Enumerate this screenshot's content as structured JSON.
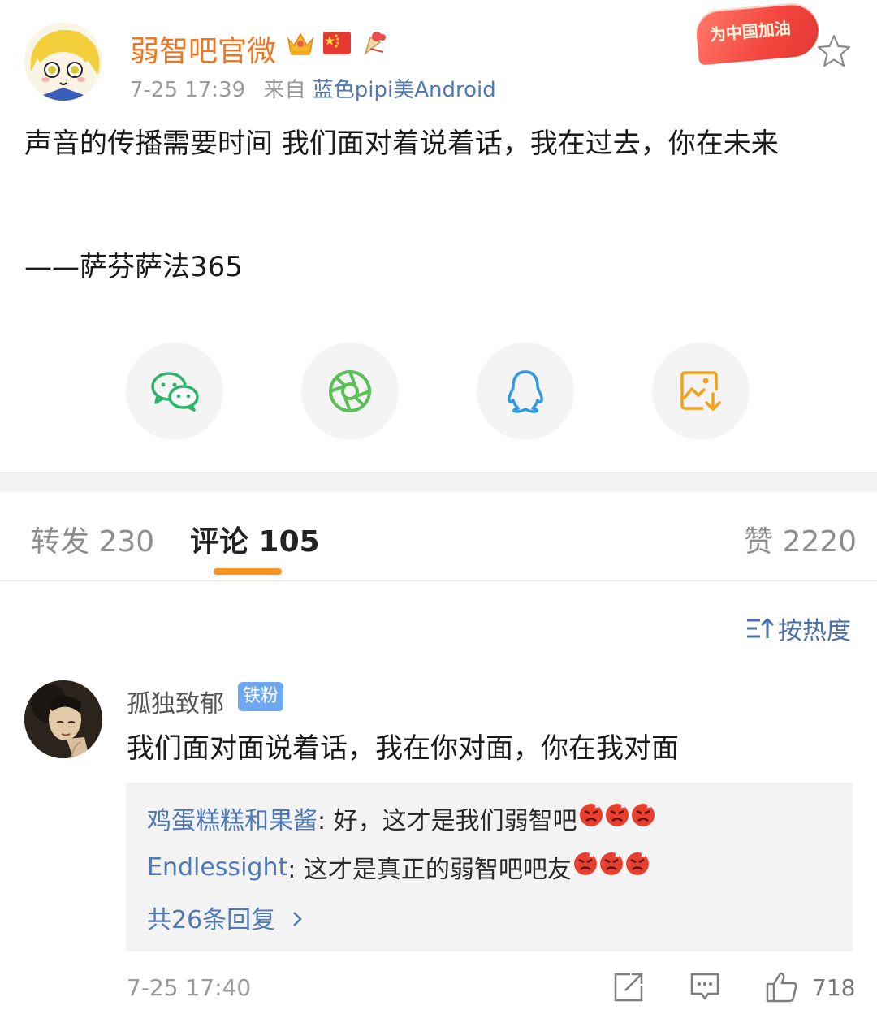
{
  "post": {
    "author": "弱智吧官微",
    "time": "7-25 17:39",
    "source_prefix": "来自",
    "source": "蓝色pipi美Android",
    "promo_label": "为中国加油",
    "text": "声音的传播需要时间 我们面对着说着话，我在过去，你在未来",
    "signature": "——萨芬萨法365",
    "badges": [
      "crown-icon",
      "china-flag-icon",
      "festive-bell-icon"
    ]
  },
  "share": {
    "items": [
      {
        "icon": "wechat-icon",
        "color": "#2cb46b"
      },
      {
        "icon": "moments-icon",
        "color": "#5cbf59"
      },
      {
        "icon": "qq-icon",
        "color": "#2d9be6"
      },
      {
        "icon": "save-image-icon",
        "color": "#f4a018"
      }
    ]
  },
  "tabs": {
    "repost": "转发 230",
    "comment": "评论 105",
    "like": "赞 2220"
  },
  "sort_label": "按热度",
  "comment": {
    "user": "孤独致郁",
    "badge": "铁粉",
    "text": "我们面对面说着话，我在你对面，你在我对面",
    "replies": [
      {
        "user": "鸡蛋糕糕和果酱",
        "text": ": 好，这才是我们弱智吧"
      },
      {
        "user": "Endlessight",
        "text": ": 这才是真正的弱智吧吧友"
      }
    ],
    "more_replies": "共26条回复",
    "time": "7-25 17:40",
    "likes": "718"
  },
  "colors": {
    "accent_orange": "#f7921e",
    "username_orange": "#f0751e",
    "link_blue": "#4f79b9"
  }
}
